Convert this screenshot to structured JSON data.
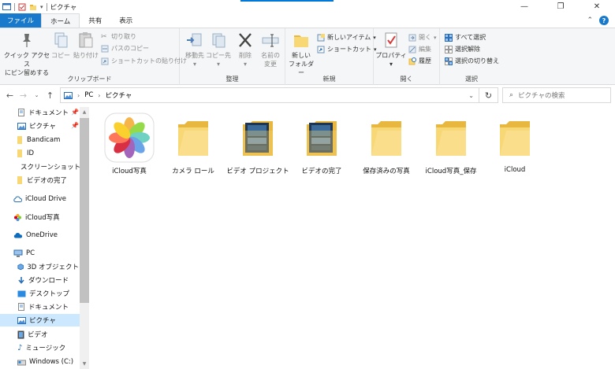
{
  "window": {
    "title": "ピクチャ"
  },
  "tabs": {
    "file": "ファイル",
    "home": "ホーム",
    "share": "共有",
    "view": "表示"
  },
  "ribbon": {
    "clipboard": {
      "label": "クリップボード",
      "quick_access": "クイック アクセス\nにピン留めする",
      "quick_access_l1": "クイック アクセス",
      "quick_access_l2": "にピン留めする",
      "copy": "コピー",
      "paste": "貼り付け",
      "cut": "切り取り",
      "copy_path": "パスのコピー",
      "paste_shortcut": "ショートカットの貼り付け"
    },
    "organize": {
      "label": "整理",
      "move_to": "移動先",
      "copy_to": "コピー先",
      "delete": "削除",
      "rename_l1": "名前の",
      "rename_l2": "変更"
    },
    "new": {
      "label": "新規",
      "new_folder_l1": "新しい",
      "new_folder_l2": "フォルダー",
      "new_item": "新しいアイテム",
      "shortcut": "ショートカット"
    },
    "open": {
      "label": "開く",
      "properties": "プロパティ",
      "open": "開く",
      "edit": "編集",
      "history": "履歴"
    },
    "select": {
      "label": "選択",
      "select_all": "すべて選択",
      "select_none": "選択解除",
      "invert": "選択の切り替え"
    }
  },
  "address": {
    "crumbs": [
      "PC",
      "ピクチャ"
    ],
    "search_placeholder": "ピクチャの検索"
  },
  "nav": {
    "quick": [
      {
        "label": "ドキュメント",
        "pinned": true
      },
      {
        "label": "ピクチャ",
        "pinned": true
      },
      {
        "label": "Bandicam"
      },
      {
        "label": "ID"
      },
      {
        "label": "スクリーンショット"
      },
      {
        "label": "ビデオの完了"
      }
    ],
    "icloud_drive": "iCloud Drive",
    "icloud_photos": "iCloud写真",
    "onedrive": "OneDrive",
    "pc": "PC",
    "pc_items": [
      {
        "label": "3D オブジェクト"
      },
      {
        "label": "ダウンロード"
      },
      {
        "label": "デスクトップ"
      },
      {
        "label": "ドキュメント"
      },
      {
        "label": "ピクチャ",
        "selected": true
      },
      {
        "label": "ビデオ"
      },
      {
        "label": "ミュージック"
      },
      {
        "label": "Windows (C:)"
      }
    ]
  },
  "files": [
    {
      "name": "iCloud写真",
      "kind": "photos-app"
    },
    {
      "name": "カメラ ロール",
      "kind": "folder"
    },
    {
      "name": "ビデオ プロジェクト",
      "kind": "folder-thumbs"
    },
    {
      "name": "ビデオの完了",
      "kind": "folder-thumbs"
    },
    {
      "name": "保存済みの写真",
      "kind": "folder"
    },
    {
      "name": "iCloud写真_保存",
      "kind": "folder"
    },
    {
      "name": "iCloud",
      "kind": "folder"
    }
  ],
  "colors": {
    "accent": "#0078d7",
    "file_tab": "#1979ca",
    "folder": "#f8d775",
    "folder_dark": "#e8b740",
    "selection": "#cce8ff"
  }
}
